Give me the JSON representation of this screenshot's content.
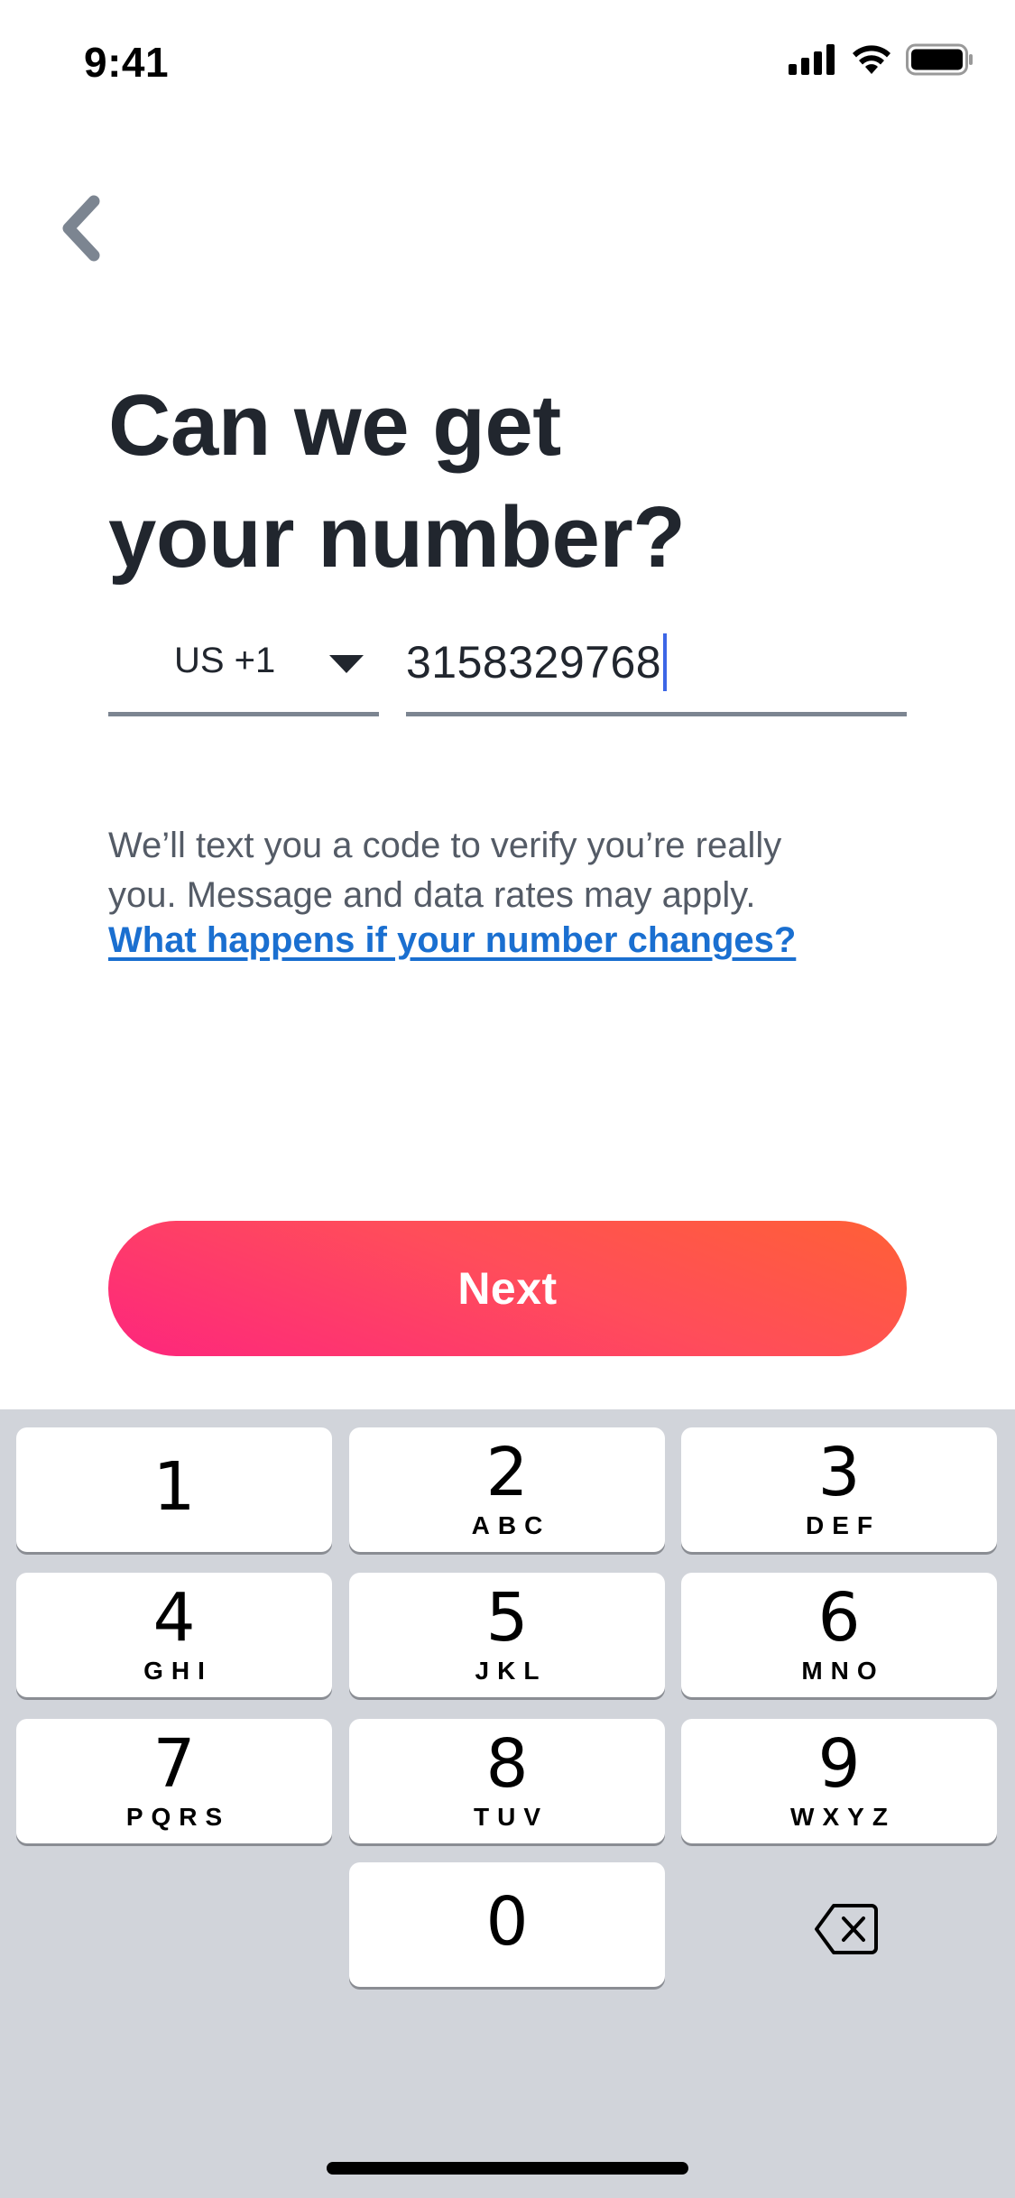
{
  "status_bar": {
    "time": "9:41"
  },
  "header": {
    "title_line1": "Can we get",
    "title_line2": "your number?"
  },
  "phone_form": {
    "country_code": "US +1",
    "phone_value": "3158329768"
  },
  "helper": {
    "text_line1": "We’ll text you a code to verify you’re really",
    "text_line2": "you. Message and data rates may apply.",
    "link_text": "What happens if your number changes?"
  },
  "actions": {
    "next_label": "Next"
  },
  "colors": {
    "accent_link": "#1a6fd0",
    "gradient_start": "#fd267d",
    "gradient_end": "#ff6036",
    "caret": "#3c66e6"
  },
  "keypad": {
    "keys": [
      {
        "num": "1",
        "letters": ""
      },
      {
        "num": "2",
        "letters": "ABC"
      },
      {
        "num": "3",
        "letters": "DEF"
      },
      {
        "num": "4",
        "letters": "GHI"
      },
      {
        "num": "5",
        "letters": "JKL"
      },
      {
        "num": "6",
        "letters": "MNO"
      },
      {
        "num": "7",
        "letters": "PQRS"
      },
      {
        "num": "8",
        "letters": "TUV"
      },
      {
        "num": "9",
        "letters": "WXYZ"
      },
      {
        "num": "0",
        "letters": ""
      }
    ],
    "delete_icon": "backspace-icon"
  },
  "icons": {
    "back": "chevron-left-icon",
    "caret": "caret-down-icon",
    "signal": "cellular-signal-icon",
    "wifi": "wifi-icon",
    "battery": "battery-icon"
  }
}
